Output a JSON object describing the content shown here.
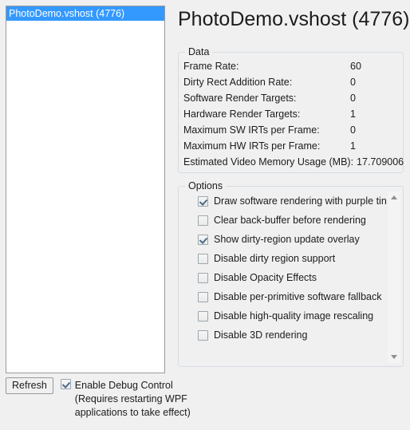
{
  "window": {
    "background_color": "#f0f0f0",
    "accent_color": "#3399ff"
  },
  "process_list": {
    "items": [
      {
        "label": "PhotoDemo.vshost (4776)",
        "selected": true
      }
    ]
  },
  "bottom_bar": {
    "refresh_label": "Refresh",
    "debug_control": {
      "checked": true,
      "label": "Enable Debug Control (Requires restarting WPF applications to take effect)"
    }
  },
  "header": {
    "title": "PhotoDemo.vshost (4776)"
  },
  "data_group": {
    "legend": "Data",
    "rows": [
      {
        "label": "Frame Rate:",
        "value": "60",
        "wide": false
      },
      {
        "label": "Dirty Rect Addition Rate:",
        "value": "0",
        "wide": false
      },
      {
        "label": "Software Render Targets:",
        "value": "0",
        "wide": false
      },
      {
        "label": "Hardware Render Targets:",
        "value": "1",
        "wide": false
      },
      {
        "label": "Maximum SW IRTs per Frame:",
        "value": "0",
        "wide": false
      },
      {
        "label": "Maximum HW IRTs per Frame:",
        "value": "1",
        "wide": false
      },
      {
        "label": "Estimated Video Memory Usage (MB):",
        "value": "17.709006",
        "wide": true
      }
    ]
  },
  "options_group": {
    "legend": "Options",
    "items": [
      {
        "label": "Draw software rendering with purple tint",
        "checked": true
      },
      {
        "label": "Clear back-buffer before rendering",
        "checked": false
      },
      {
        "label": "Show dirty-region update overlay",
        "checked": true
      },
      {
        "label": "Disable dirty region support",
        "checked": false
      },
      {
        "label": "Disable Opacity Effects",
        "checked": false
      },
      {
        "label": "Disable per-primitive software fallback",
        "checked": false
      },
      {
        "label": "Disable high-quality image rescaling",
        "checked": false
      },
      {
        "label": "Disable 3D rendering",
        "checked": false
      }
    ],
    "scrollbar": {
      "up_arrow": "scroll-up-arrow",
      "down_arrow": "scroll-down-arrow"
    }
  }
}
